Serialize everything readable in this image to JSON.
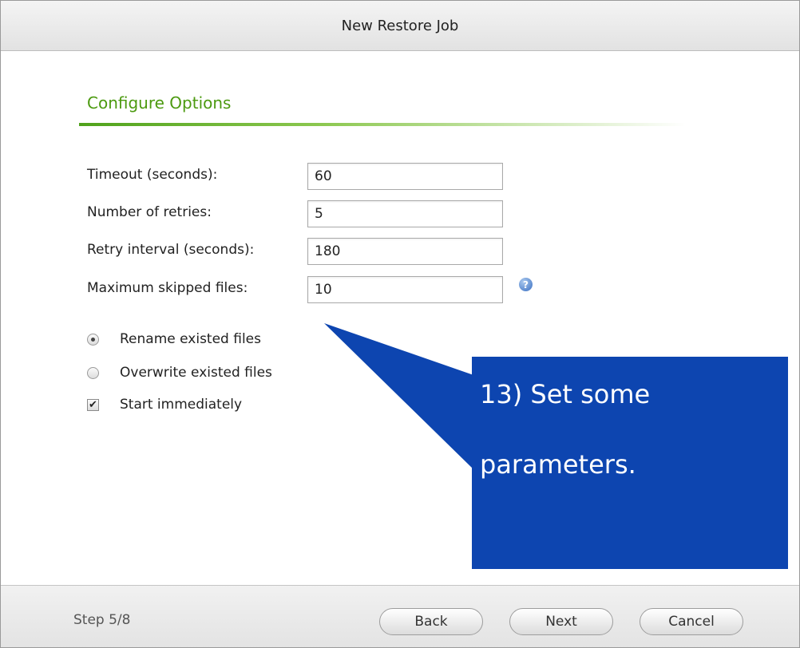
{
  "window": {
    "title": "New Restore Job"
  },
  "section": {
    "title": "Configure Options"
  },
  "fields": [
    {
      "label": "Timeout (seconds):",
      "value": "60"
    },
    {
      "label": "Number of retries:",
      "value": "5"
    },
    {
      "label": "Retry interval (seconds):",
      "value": "180"
    },
    {
      "label": "Maximum skipped files:",
      "value": "10"
    }
  ],
  "help_icon": {
    "icon": "help-icon",
    "glyph": "?"
  },
  "options": [
    {
      "type": "radio",
      "label": "Rename existed files",
      "checked": true
    },
    {
      "type": "radio",
      "label": "Overwrite existed files",
      "checked": false
    },
    {
      "type": "checkbox",
      "label": "Start immediately",
      "checked": true
    }
  ],
  "callout": {
    "line1": "13) Set some",
    "line2": "parameters.",
    "color": "#0d45b0"
  },
  "footer": {
    "step": "Step 5/8",
    "back_label": "Back",
    "next_label": "Next",
    "cancel_label": "Cancel"
  },
  "colors": {
    "section_title": "#4c9a10",
    "callout_bg": "#0d45b0"
  }
}
